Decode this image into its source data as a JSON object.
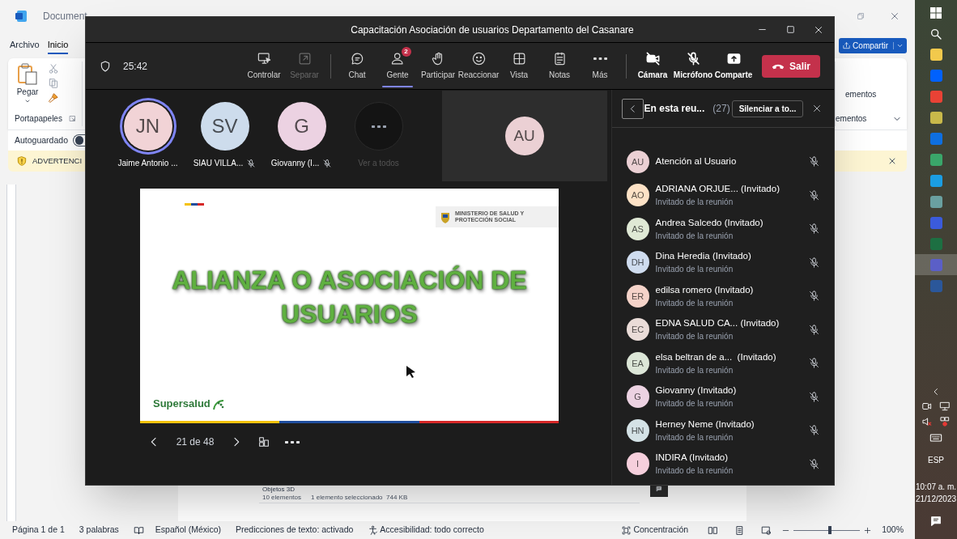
{
  "word": {
    "title": "Document",
    "menu": [
      {
        "label": "Archivo",
        "selected": false
      },
      {
        "label": "Inicio",
        "selected": true
      }
    ],
    "share_button": "Compartir",
    "ribbon": {
      "paste": "Pegar",
      "clipboard_group": "Portapapeles",
      "right_group_top": "ementos",
      "right_group_bottom": "ementos"
    },
    "autosave": {
      "label": "Autoguardado",
      "on": false
    },
    "warning": {
      "text": "ADVERTENCI"
    },
    "document": {
      "embedded_window": {
        "folder": "Objetos 3D",
        "count": "10 elementos",
        "selection": "1 elemento seleccionado  744 KB"
      }
    },
    "status_bar": {
      "items": [
        {
          "text": "Página 1 de 1",
          "kind": "plain"
        },
        {
          "text": "3 palabras",
          "kind": "plain"
        },
        {
          "text": "Español (México)",
          "kind": "language"
        },
        {
          "text": "Predicciones de texto: activado",
          "kind": "plain"
        },
        {
          "text": "Accesibilidad: todo correcto",
          "kind": "accessibility"
        }
      ],
      "focus": "Concentración",
      "zoom_slider": {
        "level": 0.55
      },
      "zoom": "100%"
    }
  },
  "teams": {
    "title": "Capacitación Asociación de usuarios Departamento del Casanare",
    "timer": "25:42",
    "toolbar_groups": [
      [
        {
          "label": "Controlar",
          "kind": "control",
          "disabled": false,
          "selected": false
        },
        {
          "label": "Separar",
          "kind": "popout",
          "disabled": true,
          "selected": false
        }
      ],
      [
        {
          "label": "Chat",
          "kind": "chat",
          "disabled": false,
          "selected": false
        },
        {
          "label": "Gente",
          "kind": "people",
          "disabled": false,
          "selected": true,
          "badge": "2"
        },
        {
          "label": "Participar",
          "kind": "hand",
          "disabled": false,
          "selected": false
        },
        {
          "label": "Reaccionar",
          "kind": "react",
          "disabled": false,
          "selected": false
        },
        {
          "label": "Vista",
          "kind": "view",
          "disabled": false,
          "selected": false
        },
        {
          "label": "Notas",
          "kind": "notes",
          "disabled": false,
          "selected": false
        },
        {
          "label": "Más",
          "kind": "more",
          "disabled": false,
          "selected": false
        }
      ],
      [
        {
          "label": "Cámara",
          "kind": "camera",
          "disabled": false,
          "selected": false
        },
        {
          "label": "Micrófono",
          "kind": "mic",
          "disabled": false,
          "selected": false
        },
        {
          "label": "Comparte",
          "kind": "share",
          "disabled": false,
          "selected": false
        }
      ]
    ],
    "leave_button": "Salir",
    "participants": [
      {
        "initials": "JN",
        "name": "Jaime Antonio ...",
        "color": "#f1d3d6",
        "speaking": true,
        "muted": false
      },
      {
        "initials": "SV",
        "name": "SIAU VILLA...",
        "color": "#cddcec",
        "speaking": false,
        "muted": true
      },
      {
        "initials": "G",
        "name": "Giovanny (I...",
        "color": "#ecd2e2",
        "speaking": false,
        "muted": true
      }
    ],
    "see_all": "Ver a todos",
    "tile": {
      "initials": "AU",
      "color": "#ebd0d4"
    },
    "slide": {
      "ministry": "MINISTERIO DE SALUD Y PROTECCIÓN SOCIAL",
      "title": "ALIANZA O ASOCIACIÓN DE USUARIOS",
      "brand": "Supersalud",
      "page": "21 de 48"
    },
    "panel": {
      "title": "En esta reu...",
      "count": "(27)",
      "mute_all": "Silenciar a to...",
      "people": [
        {
          "initials": "AU",
          "name": "Atención al Usuario",
          "color": "#ebd0d4",
          "muted": true
        },
        {
          "initials": "AO",
          "name": "ADRIANA ORJUE... (Invitado)",
          "role": "Invitado de la reunión",
          "color": "#fde2c6",
          "muted": true
        },
        {
          "initials": "AS",
          "name": "Andrea Salcedo (Invitado)",
          "role": "Invitado de la reunión",
          "color": "#dfe9d5",
          "muted": true
        },
        {
          "initials": "DH",
          "name": "Dina Heredia (Invitado)",
          "role": "Invitado de la reunión",
          "color": "#cfdcef",
          "muted": true
        },
        {
          "initials": "ER",
          "name": "edilsa romero (Invitado)",
          "role": "Invitado de la reunión",
          "color": "#f5d3c9",
          "muted": true
        },
        {
          "initials": "EC",
          "name": "EDNA SALUD CA... (Invitado)",
          "role": "Invitado de la reunión",
          "color": "#eadcd8",
          "muted": true
        },
        {
          "initials": "EA",
          "name": "elsa beltran de a...  (Invitado)",
          "role": "Invitado de la reunión",
          "color": "#dce6d7",
          "muted": true
        },
        {
          "initials": "G",
          "name": "Giovanny (Invitado)",
          "role": "Invitado de la reunión",
          "color": "#ecd2e2",
          "muted": true
        },
        {
          "initials": "HN",
          "name": "Herney Neme (Invitado)",
          "role": "Invitado de la reunión",
          "color": "#d4e2e6",
          "muted": true
        },
        {
          "initials": "I",
          "name": "INDIRA (Invitado)",
          "role": "Invitado de la reunión",
          "color": "#f6cfdc",
          "muted": true
        }
      ]
    }
  },
  "taskbar": {
    "apps": [
      {
        "color": "#f2c94c",
        "selected": false
      },
      {
        "color": "#0061fe",
        "selected": false
      },
      {
        "color": "#e94235",
        "selected": false
      },
      {
        "color": "#c9b94a",
        "selected": false
      },
      {
        "color": "#0e6fe0",
        "selected": false
      },
      {
        "color": "#3aa66a",
        "selected": false
      },
      {
        "color": "#1b9de2",
        "selected": false
      },
      {
        "color": "#6aa0a0",
        "selected": false
      },
      {
        "color": "#3b5bdb",
        "selected": false
      },
      {
        "color": "#1d6f42",
        "selected": false
      },
      {
        "color": "#5b5fc7",
        "selected": true
      },
      {
        "color": "#2b579a",
        "selected": false
      }
    ],
    "language": "ESP",
    "time": "10:07 a. m.",
    "date": "21/12/2023"
  }
}
